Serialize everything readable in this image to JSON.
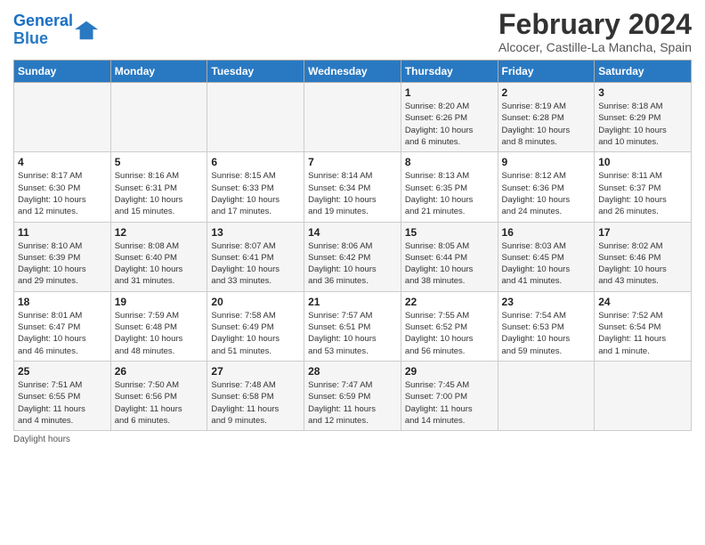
{
  "header": {
    "logo_line1": "General",
    "logo_line2": "Blue",
    "title": "February 2024",
    "subtitle": "Alcocer, Castille-La Mancha, Spain"
  },
  "days_of_week": [
    "Sunday",
    "Monday",
    "Tuesday",
    "Wednesday",
    "Thursday",
    "Friday",
    "Saturday"
  ],
  "weeks": [
    [
      {
        "day": "",
        "info": ""
      },
      {
        "day": "",
        "info": ""
      },
      {
        "day": "",
        "info": ""
      },
      {
        "day": "",
        "info": ""
      },
      {
        "day": "1",
        "info": "Sunrise: 8:20 AM\nSunset: 6:26 PM\nDaylight: 10 hours\nand 6 minutes."
      },
      {
        "day": "2",
        "info": "Sunrise: 8:19 AM\nSunset: 6:28 PM\nDaylight: 10 hours\nand 8 minutes."
      },
      {
        "day": "3",
        "info": "Sunrise: 8:18 AM\nSunset: 6:29 PM\nDaylight: 10 hours\nand 10 minutes."
      }
    ],
    [
      {
        "day": "4",
        "info": "Sunrise: 8:17 AM\nSunset: 6:30 PM\nDaylight: 10 hours\nand 12 minutes."
      },
      {
        "day": "5",
        "info": "Sunrise: 8:16 AM\nSunset: 6:31 PM\nDaylight: 10 hours\nand 15 minutes."
      },
      {
        "day": "6",
        "info": "Sunrise: 8:15 AM\nSunset: 6:33 PM\nDaylight: 10 hours\nand 17 minutes."
      },
      {
        "day": "7",
        "info": "Sunrise: 8:14 AM\nSunset: 6:34 PM\nDaylight: 10 hours\nand 19 minutes."
      },
      {
        "day": "8",
        "info": "Sunrise: 8:13 AM\nSunset: 6:35 PM\nDaylight: 10 hours\nand 21 minutes."
      },
      {
        "day": "9",
        "info": "Sunrise: 8:12 AM\nSunset: 6:36 PM\nDaylight: 10 hours\nand 24 minutes."
      },
      {
        "day": "10",
        "info": "Sunrise: 8:11 AM\nSunset: 6:37 PM\nDaylight: 10 hours\nand 26 minutes."
      }
    ],
    [
      {
        "day": "11",
        "info": "Sunrise: 8:10 AM\nSunset: 6:39 PM\nDaylight: 10 hours\nand 29 minutes."
      },
      {
        "day": "12",
        "info": "Sunrise: 8:08 AM\nSunset: 6:40 PM\nDaylight: 10 hours\nand 31 minutes."
      },
      {
        "day": "13",
        "info": "Sunrise: 8:07 AM\nSunset: 6:41 PM\nDaylight: 10 hours\nand 33 minutes."
      },
      {
        "day": "14",
        "info": "Sunrise: 8:06 AM\nSunset: 6:42 PM\nDaylight: 10 hours\nand 36 minutes."
      },
      {
        "day": "15",
        "info": "Sunrise: 8:05 AM\nSunset: 6:44 PM\nDaylight: 10 hours\nand 38 minutes."
      },
      {
        "day": "16",
        "info": "Sunrise: 8:03 AM\nSunset: 6:45 PM\nDaylight: 10 hours\nand 41 minutes."
      },
      {
        "day": "17",
        "info": "Sunrise: 8:02 AM\nSunset: 6:46 PM\nDaylight: 10 hours\nand 43 minutes."
      }
    ],
    [
      {
        "day": "18",
        "info": "Sunrise: 8:01 AM\nSunset: 6:47 PM\nDaylight: 10 hours\nand 46 minutes."
      },
      {
        "day": "19",
        "info": "Sunrise: 7:59 AM\nSunset: 6:48 PM\nDaylight: 10 hours\nand 48 minutes."
      },
      {
        "day": "20",
        "info": "Sunrise: 7:58 AM\nSunset: 6:49 PM\nDaylight: 10 hours\nand 51 minutes."
      },
      {
        "day": "21",
        "info": "Sunrise: 7:57 AM\nSunset: 6:51 PM\nDaylight: 10 hours\nand 53 minutes."
      },
      {
        "day": "22",
        "info": "Sunrise: 7:55 AM\nSunset: 6:52 PM\nDaylight: 10 hours\nand 56 minutes."
      },
      {
        "day": "23",
        "info": "Sunrise: 7:54 AM\nSunset: 6:53 PM\nDaylight: 10 hours\nand 59 minutes."
      },
      {
        "day": "24",
        "info": "Sunrise: 7:52 AM\nSunset: 6:54 PM\nDaylight: 11 hours\nand 1 minute."
      }
    ],
    [
      {
        "day": "25",
        "info": "Sunrise: 7:51 AM\nSunset: 6:55 PM\nDaylight: 11 hours\nand 4 minutes."
      },
      {
        "day": "26",
        "info": "Sunrise: 7:50 AM\nSunset: 6:56 PM\nDaylight: 11 hours\nand 6 minutes."
      },
      {
        "day": "27",
        "info": "Sunrise: 7:48 AM\nSunset: 6:58 PM\nDaylight: 11 hours\nand 9 minutes."
      },
      {
        "day": "28",
        "info": "Sunrise: 7:47 AM\nSunset: 6:59 PM\nDaylight: 11 hours\nand 12 minutes."
      },
      {
        "day": "29",
        "info": "Sunrise: 7:45 AM\nSunset: 7:00 PM\nDaylight: 11 hours\nand 14 minutes."
      },
      {
        "day": "",
        "info": ""
      },
      {
        "day": "",
        "info": ""
      }
    ]
  ],
  "footer": {
    "daylight_label": "Daylight hours"
  }
}
